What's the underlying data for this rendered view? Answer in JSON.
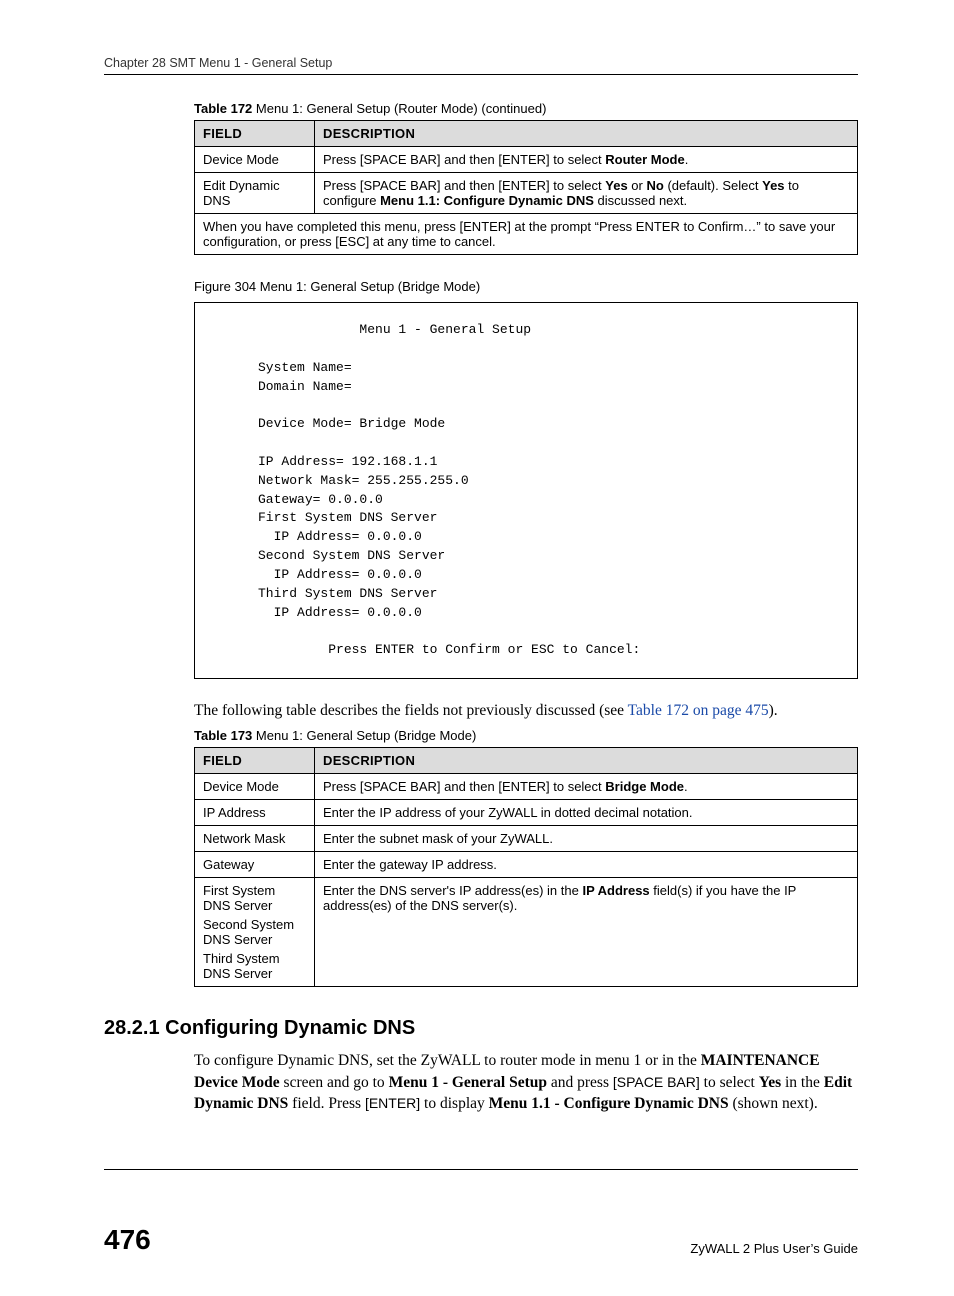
{
  "running_head": "Chapter 28 SMT Menu 1 - General Setup",
  "table172": {
    "caption_bold": "Table 172",
    "caption_rest": "   Menu 1: General Setup (Router Mode) (continued)",
    "h_field": "FIELD",
    "h_desc": "DESCRIPTION",
    "rows": [
      {
        "field": "Device Mode",
        "desc_pre": "Press [SPACE BAR] and then [ENTER] to select ",
        "desc_bold1": "Router Mode",
        "desc_post": "."
      },
      {
        "field": "Edit Dynamic DNS",
        "p1": "Press [SPACE BAR] and then [ENTER] to select ",
        "b1": "Yes",
        "p2": " or ",
        "b2": "No",
        "p3": " (default). Select ",
        "b3": "Yes",
        "p4": " to configure ",
        "b4": "Menu 1.1: Configure Dynamic DNS",
        "p5": " discussed next."
      }
    ],
    "footnote": "When you have completed this menu, press [ENTER] at the prompt “Press ENTER to Confirm…” to save your configuration, or press [ESC] at any time to cancel."
  },
  "figure304": {
    "caption_bold": "Figure 304",
    "caption_rest": "   Menu 1: General Setup (Bridge Mode)",
    "text": "                  Menu 1 - General Setup\n\n     System Name=\n     Domain Name=\n\n     Device Mode= Bridge Mode\n\n     IP Address= 192.168.1.1\n     Network Mask= 255.255.255.0\n     Gateway= 0.0.0.0\n     First System DNS Server\n       IP Address= 0.0.0.0\n     Second System DNS Server\n       IP Address= 0.0.0.0\n     Third System DNS Server\n       IP Address= 0.0.0.0\n\n              Press ENTER to Confirm or ESC to Cancel:"
  },
  "intro_para_pre": "The following table describes the fields not previously discussed (see ",
  "intro_para_link": "Table 172 on page 475",
  "intro_para_post": ").",
  "table173": {
    "caption_bold": "Table 173",
    "caption_rest": "   Menu 1: General Setup (Bridge Mode)",
    "h_field": "FIELD",
    "h_desc": "DESCRIPTION",
    "r1_field": "Device Mode",
    "r1_pre": "Press [SPACE BAR] and then [ENTER] to select ",
    "r1_bold": "Bridge Mode",
    "r1_post": ".",
    "r2_field": "IP Address",
    "r2_desc": "Enter the IP address of your ZyWALL in dotted decimal notation.",
    "r3_field": "Network Mask",
    "r3_desc": "Enter the subnet mask of your ZyWALL.",
    "r4_field": "Gateway",
    "r4_desc": "Enter the gateway IP address.",
    "r5_field_l1": "First System DNS Server",
    "r5_field_l2": "Second System DNS Server",
    "r5_field_l3": "Third System DNS Server",
    "r5_pre": "Enter the DNS server's IP address(es) in the ",
    "r5_bold": "IP Address",
    "r5_post": " field(s) if  you have the IP address(es) of the DNS server(s)."
  },
  "section": {
    "heading": "28.2.1  Configuring Dynamic DNS",
    "p_pre": "To configure Dynamic DNS, set the ZyWALL to router mode in menu 1 or in the ",
    "p_b1": "MAINTENANCE Device Mode",
    "p_m1": " screen and go to ",
    "p_b2": "Menu 1 - General Setup",
    "p_m2": " and press ",
    "p_sans1": "[SPACE BAR]",
    "p_m3": " to select ",
    "p_b3": "Yes",
    "p_m4": " in the ",
    "p_b4": "Edit Dynamic DNS",
    "p_m5": " field. Press ",
    "p_sans2": "[ENTER]",
    "p_m6": " to display ",
    "p_b5": "Menu 1.1 - Configure Dynamic DNS",
    "p_m7": " (shown next)."
  },
  "footer": {
    "page": "476",
    "guide": "ZyWALL 2 Plus User’s Guide"
  }
}
